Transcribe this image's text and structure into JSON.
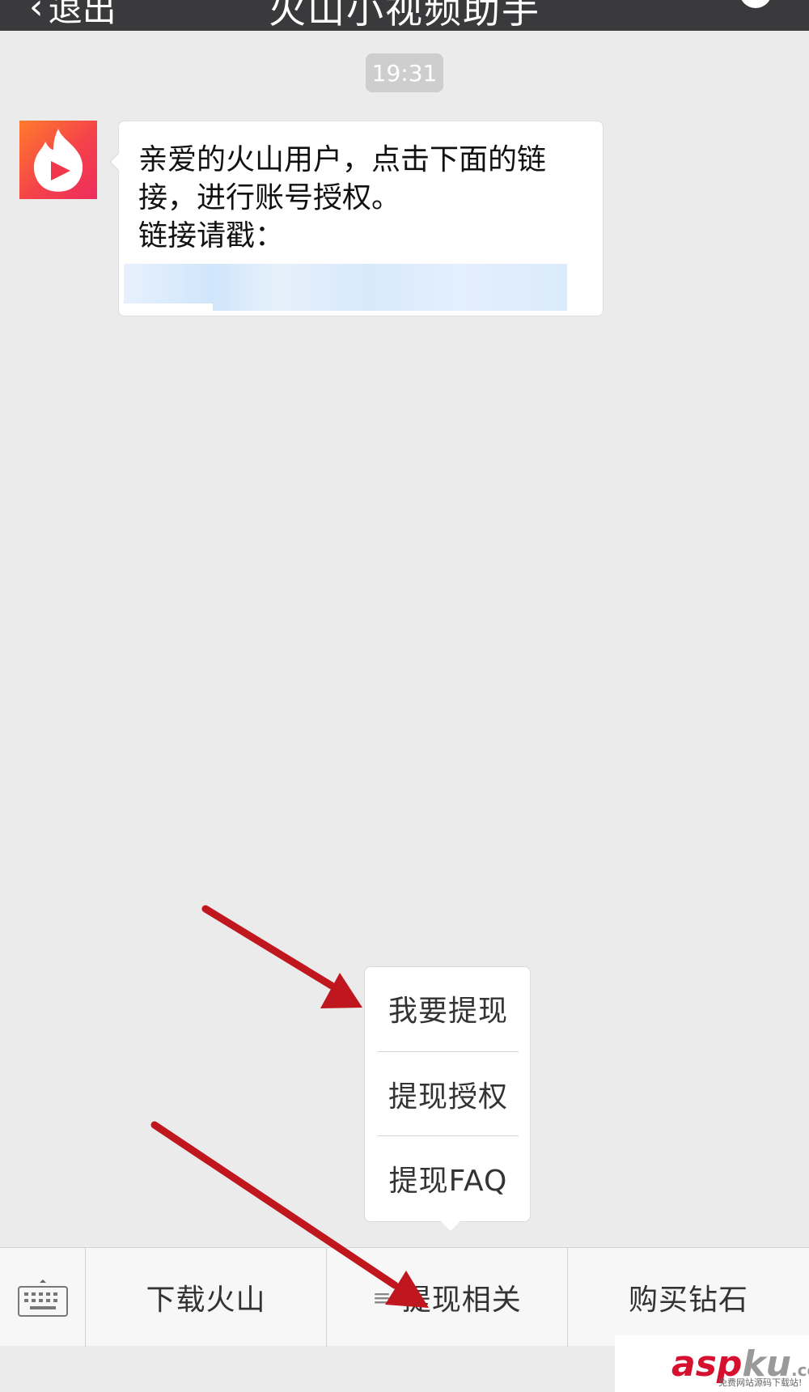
{
  "navbar": {
    "back_label": "退出",
    "title": "火山小视频助手"
  },
  "chat": {
    "timestamp": "19:31",
    "message": {
      "line1": "亲爱的火山用户，点击下面的链",
      "line2": "接，进行账号授权。",
      "line3": "链接请戳："
    }
  },
  "popup_menu": {
    "items": [
      {
        "label": "我要提现"
      },
      {
        "label": "提现授权"
      },
      {
        "label": "提现FAQ"
      }
    ]
  },
  "bottom_menu": {
    "items": [
      {
        "label": "下载火山"
      },
      {
        "label": "提现相关"
      },
      {
        "label": "购买钻石"
      }
    ]
  },
  "watermark": {
    "main": "asp",
    "ku": "ku",
    "suffix": ".com",
    "sub": "免费网站源码下载站!"
  },
  "colors": {
    "arrow": "#c0161e",
    "background": "#ebebeb",
    "navbar": "#3a3a3c"
  },
  "icons": [
    "chevron-left-icon",
    "person-icon",
    "huoshan-logo-icon",
    "keyboard-icon",
    "menu-icon"
  ]
}
